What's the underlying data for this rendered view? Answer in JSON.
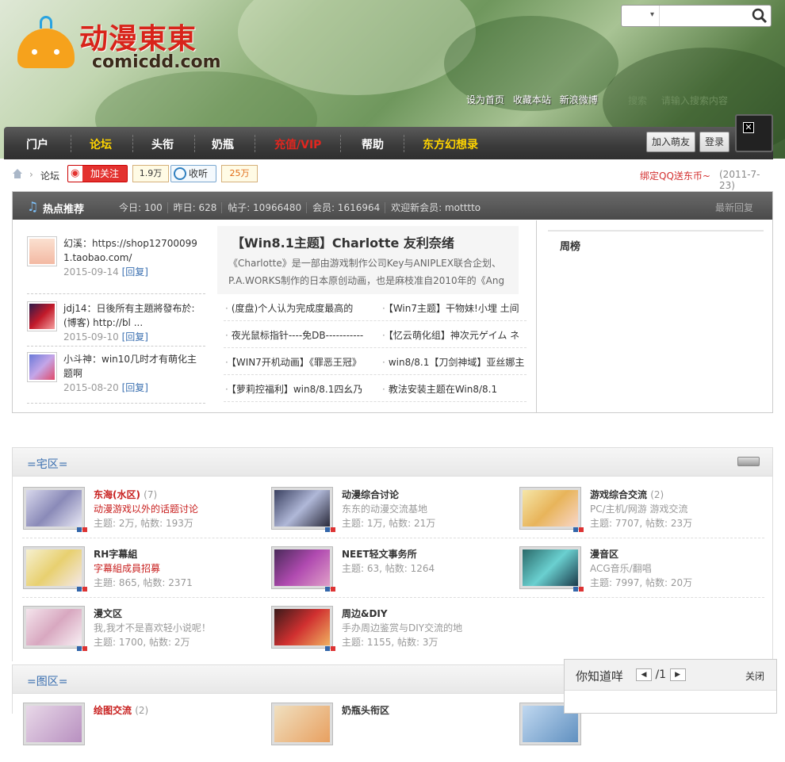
{
  "logo": {
    "title": "动漫東東",
    "domain": "comicdd.com"
  },
  "search": {
    "placeholder": "",
    "select": ""
  },
  "quick": {
    "links": [
      "设为首页",
      "收藏本站",
      "新浪微博"
    ],
    "search": "搜索",
    "hint": "请输入搜索内容"
  },
  "nav": {
    "items": [
      "门户",
      "论坛",
      "头衔",
      "奶瓶",
      "充值/VIP",
      "帮助",
      "东方幻想录"
    ],
    "join": "加入萌友",
    "login": "登录"
  },
  "crumb": {
    "forum": "论坛",
    "follow": "加关注",
    "follow_count": "1.9万",
    "listen": "收听",
    "listen_count": "25万",
    "promo": "绑定QQ送东币~",
    "date": "(2011-7-23)"
  },
  "hot": {
    "title": "热点推荐",
    "stats": [
      "今日: 100",
      "昨日: 628",
      "帖子: 10966480",
      "会员: 1616964",
      "欢迎新会员: motttto"
    ],
    "recent": "最新回复",
    "posts": [
      {
        "text": "幻溪：https://shop127000991.taobao.com/",
        "date": "2015-09-14",
        "reply": "[回复]"
      },
      {
        "text": "jdj14：日後所有主題將發布於:(博客) http://bl ...",
        "date": "2015-09-10",
        "reply": "[回复]"
      },
      {
        "text": "小斗神：win10几时才有萌化主题啊",
        "date": "2015-08-20",
        "reply": "[回复]"
      }
    ],
    "featured": {
      "title": "【Win8.1主题】Charlotte 友利奈绪",
      "desc": "《Charlotte》是一部由游戏制作公司Key与ANIPLEX联合企划、P.A.WORKS制作的日本原创动画，也是麻枝准自2010年的《Ang"
    },
    "links": [
      [
        "(度盘)个人认为完成度最高的",
        "【Win7主题】干物妹!小埋 土间"
      ],
      [
        "夜光鼠标指针----免DB-----------",
        "【忆云萌化组】神次元ゲイム ネ"
      ],
      [
        "【WIN7开机动画】《罪恶王冠》",
        "win8/8.1【刀剑神域】亚丝娜主"
      ],
      [
        "【萝莉控福利】win8/8.1四幺乃",
        "教法安装主题在Win8/8.1"
      ]
    ],
    "week": "周榜"
  },
  "zone1": {
    "title": "=宅区=",
    "forums": [
      {
        "name": "东海(水区)",
        "count": "(7)",
        "desc": "动漫游戏以外的话题讨论",
        "stats": "主题: 2万, 帖数: 193万",
        "red": true
      },
      {
        "name": "动漫综合讨论",
        "count": "",
        "desc": "东东的动漫交流基地",
        "stats": "主题: 1万, 帖数: 21万",
        "red": false
      },
      {
        "name": "游戏综合交流",
        "count": "(2)",
        "desc": "PC/主机/网游 游戏交流",
        "stats": "主题: 7707, 帖数: 23万",
        "red": false
      },
      {
        "name": "RH字幕組",
        "count": "",
        "desc": "字幕組成員招募",
        "stats": "主題: 865, 帖数: 2371",
        "red": false,
        "descred": true
      },
      {
        "name": "NEET轻文事务所",
        "count": "",
        "desc": "",
        "stats": "主题: 63, 帖数: 1264",
        "red": false
      },
      {
        "name": "漫音区",
        "count": "",
        "desc": "ACG音乐/翻唱",
        "stats": "主题: 7997, 帖数: 20万",
        "red": false
      },
      {
        "name": "漫文区",
        "count": "",
        "desc": "我,我才不是喜欢轻小说呢！",
        "stats": "主题: 1700, 帖数: 2万",
        "red": false
      },
      {
        "name": "周边&DIY",
        "count": "",
        "desc": "手办周边鉴赏与DIY交流的地",
        "stats": "主题: 1155, 帖数: 3万",
        "red": false
      }
    ]
  },
  "zone2": {
    "title": "=图区=",
    "forums": [
      {
        "name": "绘图交流",
        "count": "(2)"
      },
      {
        "name": "奶瓶头衔区",
        "count": ""
      }
    ]
  },
  "tip": {
    "title": "你知道咩",
    "page": "/1",
    "close": "关闭"
  },
  "colors": {
    "accent": "#3a6fb0",
    "red": "#c8201f",
    "navbg": "#3a3a3a",
    "navyellow": "#ffd400"
  }
}
